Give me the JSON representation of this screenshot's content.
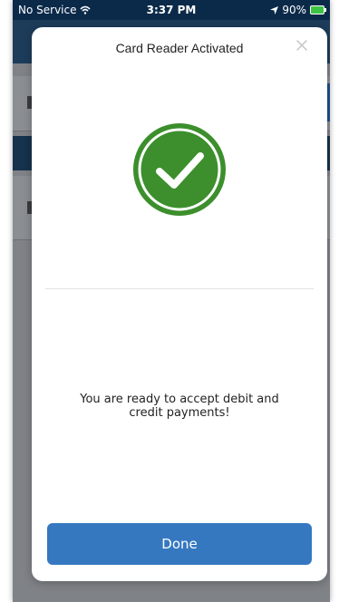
{
  "status_bar": {
    "carrier": "No Service",
    "time": "3:37 PM",
    "battery": "90%"
  },
  "modal": {
    "title": "Card Reader Activated",
    "message": "You are ready to accept debit and credit payments!",
    "done_label": "Done"
  },
  "icons": {
    "wifi": "wifi-icon",
    "location": "location-arrow-icon",
    "battery": "battery-charging-icon",
    "close": "close-icon",
    "success": "check-circle-icon"
  },
  "colors": {
    "status_bar_bg": "#0b2a4a",
    "success_green": "#3c8f2c",
    "primary_button": "#3578c0",
    "overlay_dim": "#7f8287"
  }
}
